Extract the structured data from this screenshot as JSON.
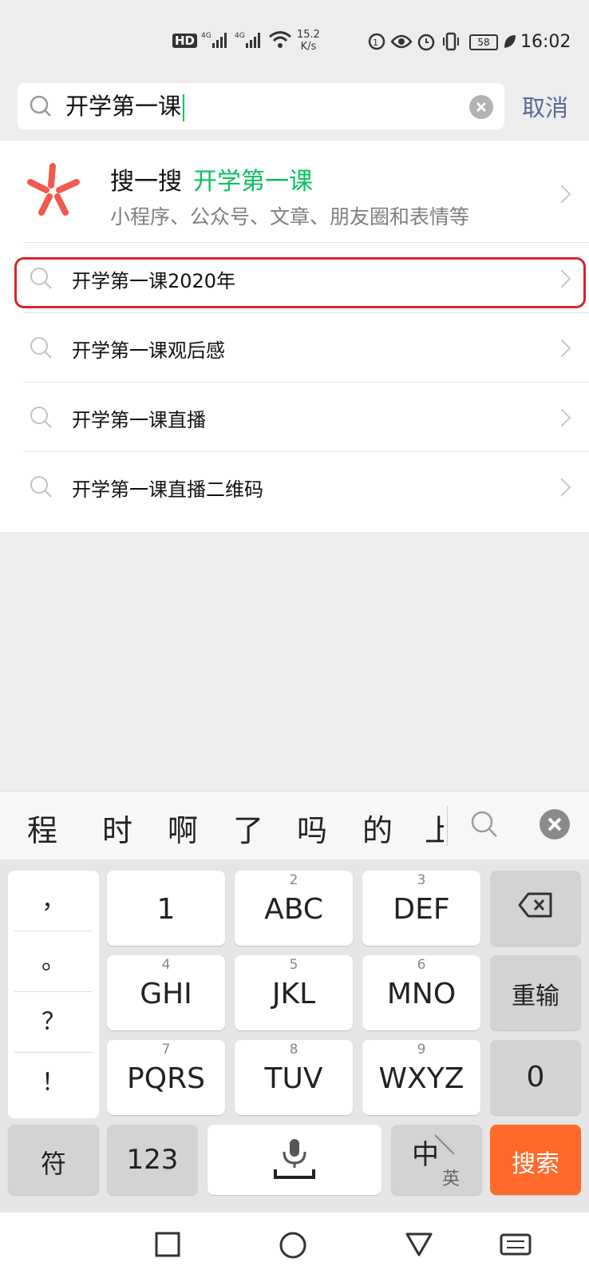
{
  "status_bar": {
    "network_speed_value": "15.2",
    "network_speed_unit": "K/s",
    "battery": "58",
    "time": "16:02"
  },
  "search": {
    "query": "开学第一课",
    "cancel_label": "取消"
  },
  "souyisou": {
    "title": "搜一搜",
    "keyword": "开学第一课",
    "subtitle": "小程序、公众号、文章、朋友圈和表情等"
  },
  "suggestions": [
    "开学第一课2020年",
    "开学第一课观后感",
    "开学第一课直播",
    "开学第一课直播二维码"
  ],
  "keyboard": {
    "candidates": [
      "程",
      "时",
      "啊",
      "了",
      "吗",
      "的",
      "上"
    ],
    "punctuation": [
      "，",
      "。",
      "？",
      "！"
    ],
    "keys": [
      {
        "num": "",
        "main": "1"
      },
      {
        "num": "2",
        "main": "ABC"
      },
      {
        "num": "3",
        "main": "DEF"
      },
      {
        "num": "4",
        "main": "GHI"
      },
      {
        "num": "5",
        "main": "JKL"
      },
      {
        "num": "6",
        "main": "MNO"
      },
      {
        "num": "7",
        "main": "PQRS"
      },
      {
        "num": "8",
        "main": "TUV"
      },
      {
        "num": "9",
        "main": "WXYZ"
      }
    ],
    "reenter_label": "重输",
    "zero_label": "0",
    "symbols_label": "符",
    "numbers_label": "123",
    "lang_main": "中",
    "lang_sub": "英",
    "search_label": "搜索"
  }
}
